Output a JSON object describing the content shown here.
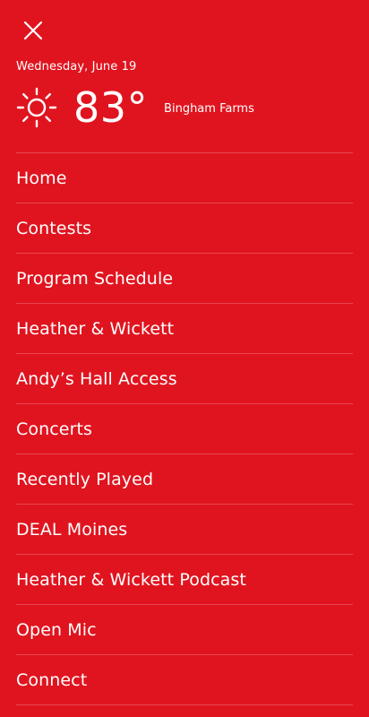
{
  "colors": {
    "background": "#e0141f",
    "text": "#ffffff"
  },
  "header": {
    "close_icon": "close-icon"
  },
  "weather": {
    "date": "Wednesday, June 19",
    "icon": "sun-icon",
    "temperature": "83°",
    "location": "Bingham Farms"
  },
  "menu": {
    "items": [
      {
        "label": "Home"
      },
      {
        "label": "Contests"
      },
      {
        "label": "Program Schedule"
      },
      {
        "label": "Heather & Wickett"
      },
      {
        "label": "Andy’s Hall Access"
      },
      {
        "label": "Concerts"
      },
      {
        "label": "Recently Played"
      },
      {
        "label": "DEAL Moines"
      },
      {
        "label": "Heather & Wickett Podcast"
      },
      {
        "label": "Open Mic"
      },
      {
        "label": "Connect"
      }
    ]
  }
}
